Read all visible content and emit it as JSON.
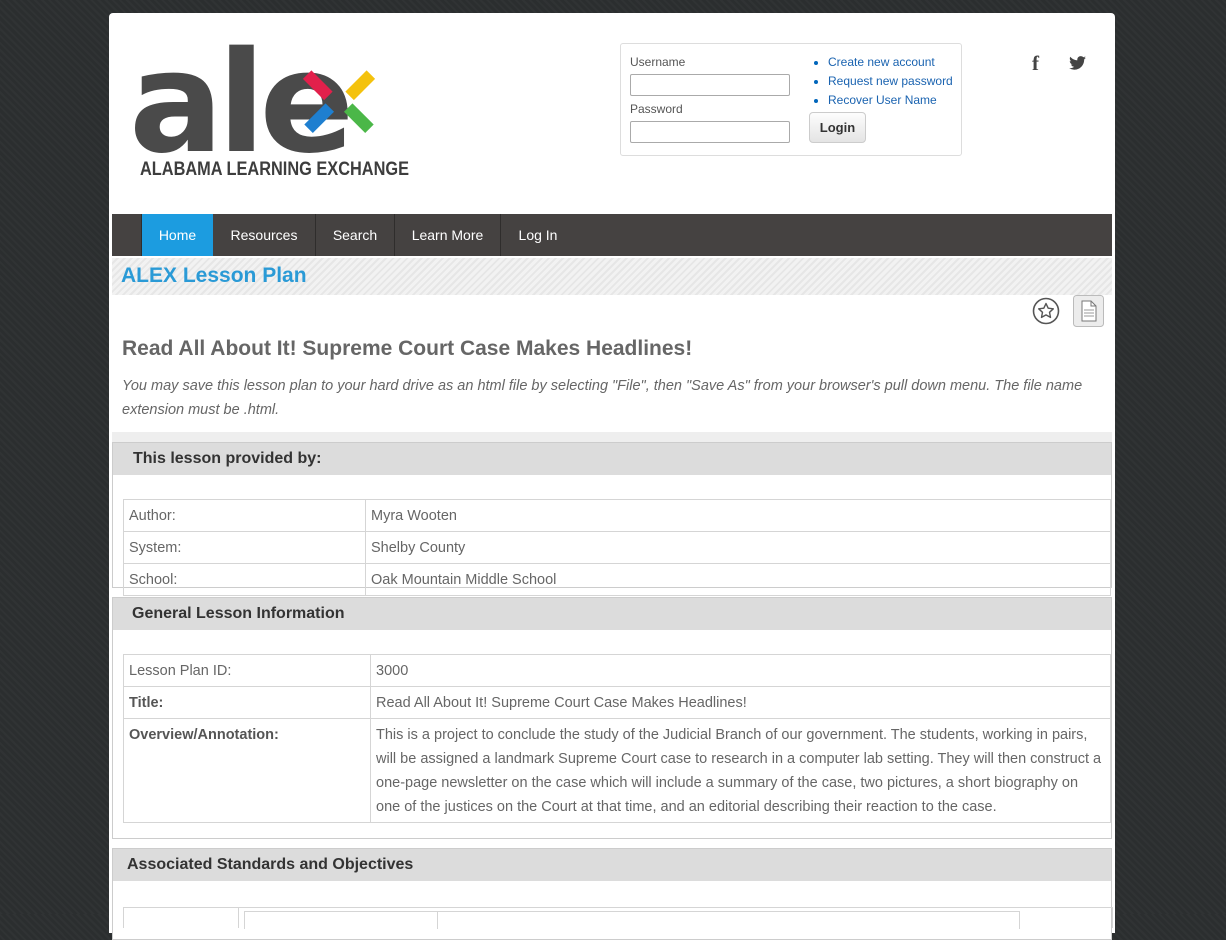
{
  "logo": {
    "wordmark": "alex",
    "tagline": "ALABAMA LEARNING EXCHANGE"
  },
  "login": {
    "username_label": "Username",
    "password_label": "Password",
    "username_value": "",
    "password_value": "",
    "button": "Login",
    "links": [
      "Create new account",
      "Request new password",
      "Recover User Name"
    ]
  },
  "social": {
    "facebook": "f",
    "twitter": "twitter-icon"
  },
  "nav": [
    "Home",
    "Resources",
    "Search",
    "Learn More",
    "Log In"
  ],
  "banner_title": "ALEX Lesson Plan",
  "icons": [
    "star-icon",
    "document-icon"
  ],
  "lesson": {
    "title": "Read All About It! Supreme Court Case Makes Headlines!",
    "save_note": "You may save this lesson plan to your hard drive as an html file by selecting \"File\", then \"Save As\" from your browser's pull down menu. The file name extension must be .html."
  },
  "provided_by": {
    "header": "This lesson provided by:",
    "rows": [
      {
        "key": "Author:",
        "value": "Myra Wooten"
      },
      {
        "key": "System:",
        "value": "Shelby County"
      },
      {
        "key": "School:",
        "value": "Oak Mountain Middle School"
      }
    ]
  },
  "general": {
    "header": "General Lesson Information",
    "rows": [
      {
        "key": "Lesson Plan ID:",
        "value": "3000"
      },
      {
        "key": "Title:",
        "value": "Read All About It! Supreme Court Case Makes Headlines!"
      },
      {
        "key": "Overview/Annotation:",
        "value": "This is a project to conclude the study of the Judicial Branch of our government. The students, working in pairs, will be assigned a landmark Supreme Court case to research in a computer lab setting. They will then construct a one-page newsletter on the case which will include a summary of the case, two pictures, a short biography on one of the justices on the Court at that time, and an editorial describing their reaction to the case."
      }
    ]
  },
  "standards": {
    "header": "Associated Standards and Objectives"
  },
  "colors": {
    "nav_bg": "#454241",
    "nav_active": "#1c9ce0",
    "banner_title": "#2a9ad6"
  }
}
